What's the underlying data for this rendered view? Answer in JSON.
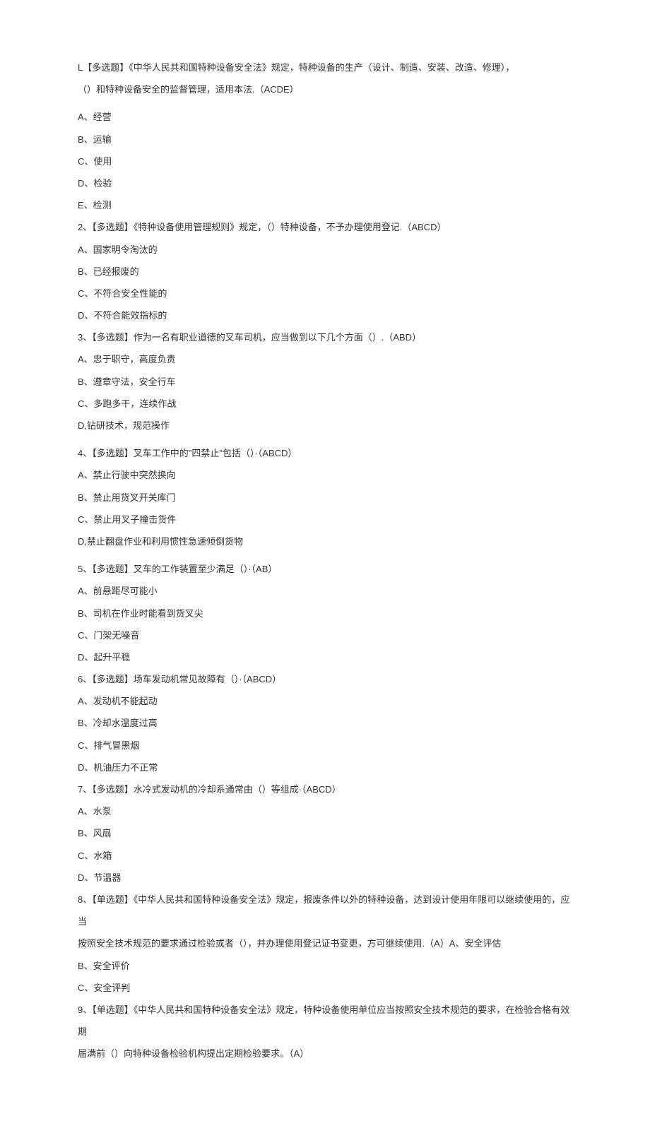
{
  "q1": {
    "line1": "L【多选题】《中华人民共和国特种设备安全法》规定，特种设备的生产（设计、制造、安装、改造、修理），",
    "line2": "（）和特种设备安全的监督管理，适用本法.（ACDE）",
    "optA": "A、经营",
    "optB": "B、运输",
    "optC": "C、使用",
    "optD": "D、检验",
    "optE": "E、检测"
  },
  "q2": {
    "text": "2、【多选题】《特种设备使用管理规则》规定，（）特种设备，不予办理使用登记.（ABCD）",
    "optA": "A、国家明令淘汰的",
    "optB": "B、已经报废的",
    "optC": "C、不符合安全性能的",
    "optD": "D、不符合能效指标的"
  },
  "q3": {
    "text": "3、【多选题】作为一名有职业道德的叉车司机，应当做到以下几个方面（）.（ABD）",
    "optA": "A、忠于职守，高度负责",
    "optB": "B、遵章守法，安全行车",
    "optC": "C、多跑多干，连续作战",
    "optD": "D,钻研技术，规范操作"
  },
  "q4": {
    "text": "4、【多选题】叉车工作中的\"四禁止\"包括（）·（ABCD）",
    "optA": "A、禁止行驶中突然换向",
    "optB": "B、禁止用货叉开关库门",
    "optC": "C、禁止用叉子撞击货件",
    "optD": "D,禁止翻盘作业和利用惯性急速倾倒货物"
  },
  "q5": {
    "text": "5、【多选题】叉车的工作装置至少满足（）·（AB）",
    "optA": "A、前悬距尽可能小",
    "optB": "B、司机在作业时能看到货叉尖",
    "optC": "C、门架无噪音",
    "optD": "D、起升平稳"
  },
  "q6": {
    "text": "6、【多选题】场车发动机常见故障有（）·（ABCD）",
    "optA": "A、发动机不能起动",
    "optB": "B、冷却水温度过高",
    "optC": "C、排气冒黑烟",
    "optD": "D、机油压力不正常"
  },
  "q7": {
    "text": "7、【多选题】水冷式发动机的冷却系通常由（）等组成·（ABCD）",
    "optA": "A、水泵",
    "optB": "B、风扇",
    "optC": "C、水箱",
    "optD": "D、节温器"
  },
  "q8": {
    "line1": "8、【单选题】《中华人民共和国特种设备安全法》规定，报废条件以外的特种设备，达到设计使用年限可以继续使用的，应当",
    "line2": "按照安全技术规范的要求通过检验或者（），并办理使用登记证书变更，方可继续使用.（A）A、安全评估",
    "optB": "B、安全评价",
    "optC": "C、安全评判"
  },
  "q9": {
    "line1": "9、【单选题】《中华人民共和国特种设备安全法》规定，特种设备使用单位应当按照安全技术规范的要求，在检验合格有效期",
    "line2": "届满前（）向特种设备检验机构提出定期检验要求。（A）"
  }
}
